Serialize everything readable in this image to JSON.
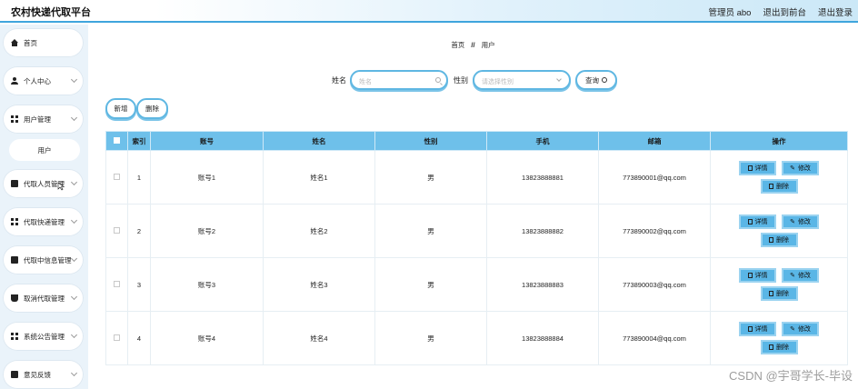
{
  "header": {
    "title": "农村快递代取平台",
    "user": "管理员 abo",
    "back_front": "退出到前台",
    "logout": "退出登录"
  },
  "sidebar": {
    "items": [
      {
        "label": "首页",
        "icon": "home-icon"
      },
      {
        "label": "个人中心",
        "icon": "user-icon"
      },
      {
        "label": "用户管理",
        "icon": "grid-icon"
      },
      {
        "label": "代取人员管理",
        "icon": "box-icon"
      },
      {
        "label": "代取快递管理",
        "icon": "grid-icon"
      },
      {
        "label": "代取中信息管理",
        "icon": "box-icon"
      },
      {
        "label": "取消代取管理",
        "icon": "cup-icon"
      },
      {
        "label": "系统公告管理",
        "icon": "grid-icon"
      },
      {
        "label": "意见反馈",
        "icon": "box-icon"
      }
    ],
    "sub_user": "用户"
  },
  "breadcrumb": {
    "home": "首页",
    "sep": "//",
    "current": "用户"
  },
  "search": {
    "name_label": "姓名",
    "name_placeholder": "姓名",
    "gender_label": "性别",
    "gender_placeholder": "请选择性别",
    "query_label": "查询"
  },
  "actions": {
    "add": "新增",
    "delete": "删除"
  },
  "table": {
    "headers": [
      "索引",
      "账号",
      "姓名",
      "性别",
      "手机",
      "邮箱",
      "操作"
    ],
    "rows": [
      {
        "index": "1",
        "account": "账号1",
        "name": "姓名1",
        "gender": "男",
        "phone": "13823888881",
        "email": "773890001@qq.com"
      },
      {
        "index": "2",
        "account": "账号2",
        "name": "姓名2",
        "gender": "男",
        "phone": "13823888882",
        "email": "773890002@qq.com"
      },
      {
        "index": "3",
        "account": "账号3",
        "name": "姓名3",
        "gender": "男",
        "phone": "13823888883",
        "email": "773890003@qq.com"
      },
      {
        "index": "4",
        "account": "账号4",
        "name": "姓名4",
        "gender": "男",
        "phone": "13823888884",
        "email": "773890004@qq.com"
      }
    ],
    "op_detail": "详情",
    "op_edit": "修改",
    "op_delete": "删除"
  },
  "watermark": "CSDN @宇哥学长-毕设",
  "colors": {
    "accent": "#5ab6e6",
    "header_border": "#3fa5dd",
    "sidebar_bg": "#eaf3fa"
  }
}
